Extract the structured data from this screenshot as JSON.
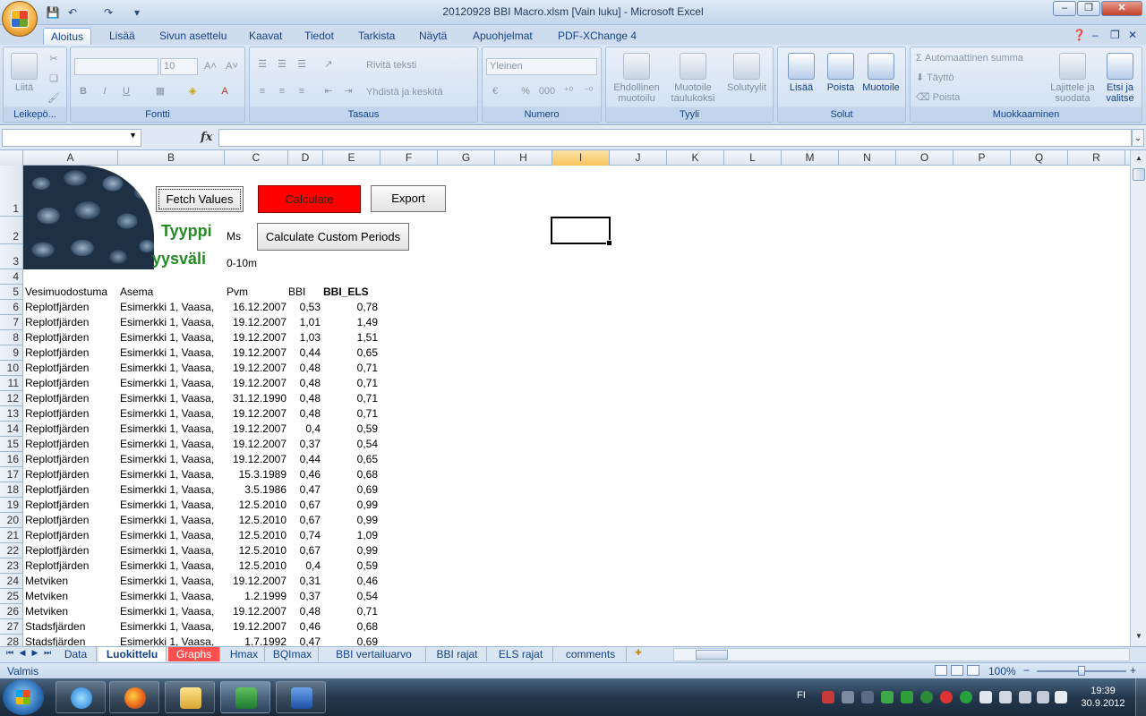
{
  "window": {
    "title": "20120928 BBI Macro.xlsm  [Vain luku] - Microsoft Excel",
    "minimize": "–",
    "maximize": "❐",
    "close": "✕"
  },
  "qat": {
    "save_icon": "💾",
    "undo_icon": "↶",
    "redo_icon": "↷",
    "customize_icon": "▾"
  },
  "ribbon_tabs": [
    "Aloitus",
    "Lisää",
    "Sivun asettelu",
    "Kaavat",
    "Tiedot",
    "Tarkista",
    "Näytä",
    "Apuohjelmat",
    "PDF-XChange 4"
  ],
  "ribbon": {
    "clipboard": {
      "label": "Leikepö...",
      "paste": "Liitä"
    },
    "font": {
      "label": "Fontti",
      "font_name": "",
      "font_size": "10",
      "bold": "B",
      "italic": "I",
      "underline": "U"
    },
    "alignment": {
      "label": "Tasaus",
      "wrap": "Rivitä teksti",
      "merge": "Yhdistä ja keskitä"
    },
    "number": {
      "label": "Numero",
      "format": "Yleinen",
      "percent": "%",
      "thousands": "000"
    },
    "styles": {
      "label": "Tyyli",
      "conditional": "Ehdollinen\nmuotoilu",
      "table": "Muotoile\ntaulukoksi",
      "cell": "Solutyylit"
    },
    "cells": {
      "label": "Solut",
      "insert": "Lisää",
      "delete": "Poista",
      "format": "Muotoile"
    },
    "editing": {
      "label": "Muokkaaminen",
      "autosum": "Automaattinen summa",
      "fill": "Täyttö",
      "clear": "Poista",
      "sort": "Lajittele ja\nsuodata",
      "find": "Etsi ja\nvalitse"
    }
  },
  "formula_bar": {
    "name_box": "",
    "fx": "fx",
    "formula": ""
  },
  "columns": [
    "A",
    "B",
    "C",
    "D",
    "E",
    "F",
    "G",
    "H",
    "I",
    "J",
    "K",
    "L",
    "M",
    "N",
    "O",
    "P",
    "Q",
    "R"
  ],
  "sheet": {
    "buttons": {
      "fetch": "Fetch Values",
      "calculate": "Calculate",
      "export": "Export",
      "custom": "Calculate Custom Periods"
    },
    "b2_label": "Tyyppi",
    "b3_label": "yysväli",
    "c2": "Ms",
    "c3": "0-10m",
    "headers": [
      "Vesimuodostuma",
      "Asema",
      "Pvm",
      "BBI",
      "BBI_ELS"
    ],
    "rows": [
      [
        "Replotfjärden",
        "Esimerkki 1, Vaasa,",
        "16.12.2007",
        "0,53",
        "0,78"
      ],
      [
        "Replotfjärden",
        "Esimerkki 1, Vaasa,",
        "19.12.2007",
        "1,01",
        "1,49"
      ],
      [
        "Replotfjärden",
        "Esimerkki 1, Vaasa,",
        "19.12.2007",
        "1,03",
        "1,51"
      ],
      [
        "Replotfjärden",
        "Esimerkki 1, Vaasa,",
        "19.12.2007",
        "0,44",
        "0,65"
      ],
      [
        "Replotfjärden",
        "Esimerkki 1, Vaasa,",
        "19.12.2007",
        "0,48",
        "0,71"
      ],
      [
        "Replotfjärden",
        "Esimerkki 1, Vaasa,",
        "19.12.2007",
        "0,48",
        "0,71"
      ],
      [
        "Replotfjärden",
        "Esimerkki 1, Vaasa,",
        "31.12.1990",
        "0,48",
        "0,71"
      ],
      [
        "Replotfjärden",
        "Esimerkki 1, Vaasa,",
        "19.12.2007",
        "0,48",
        "0,71"
      ],
      [
        "Replotfjärden",
        "Esimerkki 1, Vaasa,",
        "19.12.2007",
        "0,4",
        "0,59"
      ],
      [
        "Replotfjärden",
        "Esimerkki 1, Vaasa,",
        "19.12.2007",
        "0,37",
        "0,54"
      ],
      [
        "Replotfjärden",
        "Esimerkki 1, Vaasa,",
        "19.12.2007",
        "0,44",
        "0,65"
      ],
      [
        "Replotfjärden",
        "Esimerkki 1, Vaasa,",
        "15.3.1989",
        "0,46",
        "0,68"
      ],
      [
        "Replotfjärden",
        "Esimerkki 1, Vaasa,",
        "3.5.1986",
        "0,47",
        "0,69"
      ],
      [
        "Replotfjärden",
        "Esimerkki 1, Vaasa,",
        "12.5.2010",
        "0,67",
        "0,99"
      ],
      [
        "Replotfjärden",
        "Esimerkki 1, Vaasa,",
        "12.5.2010",
        "0,67",
        "0,99"
      ],
      [
        "Replotfjärden",
        "Esimerkki 1, Vaasa,",
        "12.5.2010",
        "0,74",
        "1,09"
      ],
      [
        "Replotfjärden",
        "Esimerkki 1, Vaasa,",
        "12.5.2010",
        "0,67",
        "0,99"
      ],
      [
        "Replotfjärden",
        "Esimerkki 1, Vaasa,",
        "12.5.2010",
        "0,4",
        "0,59"
      ],
      [
        "Metviken",
        "Esimerkki 1, Vaasa,",
        "19.12.2007",
        "0,31",
        "0,46"
      ],
      [
        "Metviken",
        "Esimerkki 1, Vaasa,",
        "1.2.1999",
        "0,37",
        "0,54"
      ],
      [
        "Metviken",
        "Esimerkki 1, Vaasa,",
        "19.12.2007",
        "0,48",
        "0,71"
      ],
      [
        "Stadsfjärden",
        "Esimerkki 1, Vaasa,",
        "19.12.2007",
        "0,46",
        "0,68"
      ],
      [
        "Stadsfjärden",
        "Esimerkki 1, Vaasa,",
        "1.7.1992",
        "0,47",
        "0,69"
      ]
    ]
  },
  "sheet_tabs": [
    "Data",
    "Luokittelu",
    "Graphs",
    "Hmax",
    "BQImax",
    "BBI vertailuarvo",
    "BBI rajat",
    "ELS rajat",
    "comments"
  ],
  "status": {
    "text": "Valmis",
    "zoom": "100%",
    "zoom_minus": "−",
    "zoom_plus": "+"
  },
  "taskbar": {
    "lang": "FI",
    "time": "19:39",
    "date": "30.9.2012"
  }
}
